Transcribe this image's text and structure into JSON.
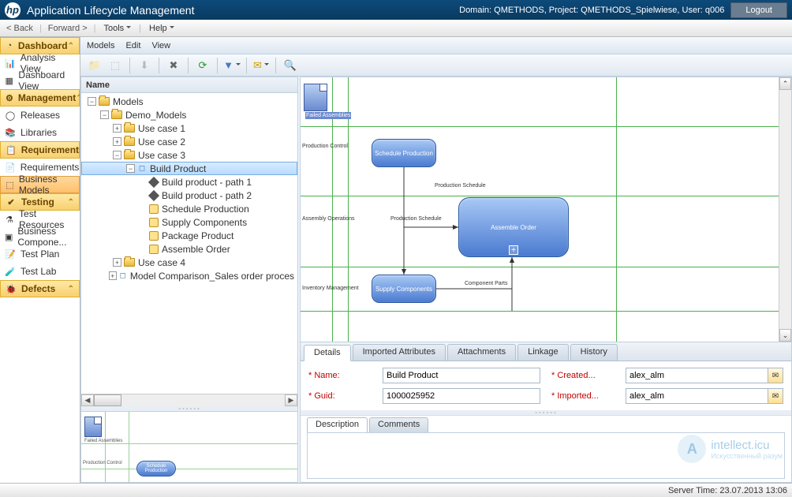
{
  "header": {
    "app_title": "Application Lifecycle Management",
    "domain_info": "Domain: QMETHODS, Project: QMETHODS_Spielwiese, User: q006",
    "logout": "Logout"
  },
  "menubar": {
    "back": "< Back",
    "forward": "Forward >",
    "tools": "Tools",
    "help": "Help"
  },
  "sidebar": {
    "groups": [
      {
        "title": "Dashboard",
        "items": [
          "Analysis View",
          "Dashboard View"
        ]
      },
      {
        "title": "Management",
        "items": [
          "Releases",
          "Libraries"
        ]
      },
      {
        "title": "Requirements",
        "items": [
          "Requirements",
          "Business Models"
        ],
        "selectedIndex": 1
      },
      {
        "title": "Testing",
        "items": [
          "Test Resources",
          "Business Compone...",
          "Test Plan",
          "Test Lab"
        ]
      },
      {
        "title": "Defects",
        "items": []
      }
    ]
  },
  "view_menu": {
    "models": "Models",
    "edit": "Edit",
    "view": "View"
  },
  "tree": {
    "header": "Name",
    "root": "Models",
    "demo": "Demo_Models",
    "uc1": "Use case 1",
    "uc2": "Use case 2",
    "uc3": "Use case 3",
    "build_product": "Build Product",
    "path1": "Build product - path 1",
    "path2": "Build product - path 2",
    "schedule": "Schedule Production",
    "supply": "Supply Components",
    "package": "Package Product",
    "assemble": "Assemble Order",
    "uc4": "Use case 4",
    "model_comp": "Model Comparison_Sales order proces"
  },
  "diagram": {
    "failed": "Failed Assemblies",
    "schedule_prod": "Schedule Production",
    "assemble_order": "Assemble Order",
    "supply_components": "Supply Components",
    "lane_prod_control": "Production Control",
    "lane_assembly": "Assembly Operations",
    "lane_inventory": "Inventory Management",
    "edge_prod_schedule": "Production Schedule",
    "edge_prod_schedule2": "Production Schedule",
    "edge_comp_parts": "Component Parts"
  },
  "details": {
    "tabs": [
      "Details",
      "Imported Attributes",
      "Attachments",
      "Linkage",
      "History"
    ],
    "active_tab": 0,
    "fields": {
      "name_label": "* Name:",
      "name_value": "Build Product",
      "guid_label": "* Guid:",
      "guid_value": "1000025952",
      "created_label": "* Created...",
      "created_value": "alex_alm",
      "imported_label": "* Imported...",
      "imported_value": "alex_alm"
    },
    "subtabs": [
      "Description",
      "Comments"
    ],
    "active_subtab": 0
  },
  "status": {
    "server_time": "Server Time: 23.07.2013 13:06"
  },
  "watermark": {
    "brand": "intellect.icu",
    "sub": "Искусственный разум"
  }
}
